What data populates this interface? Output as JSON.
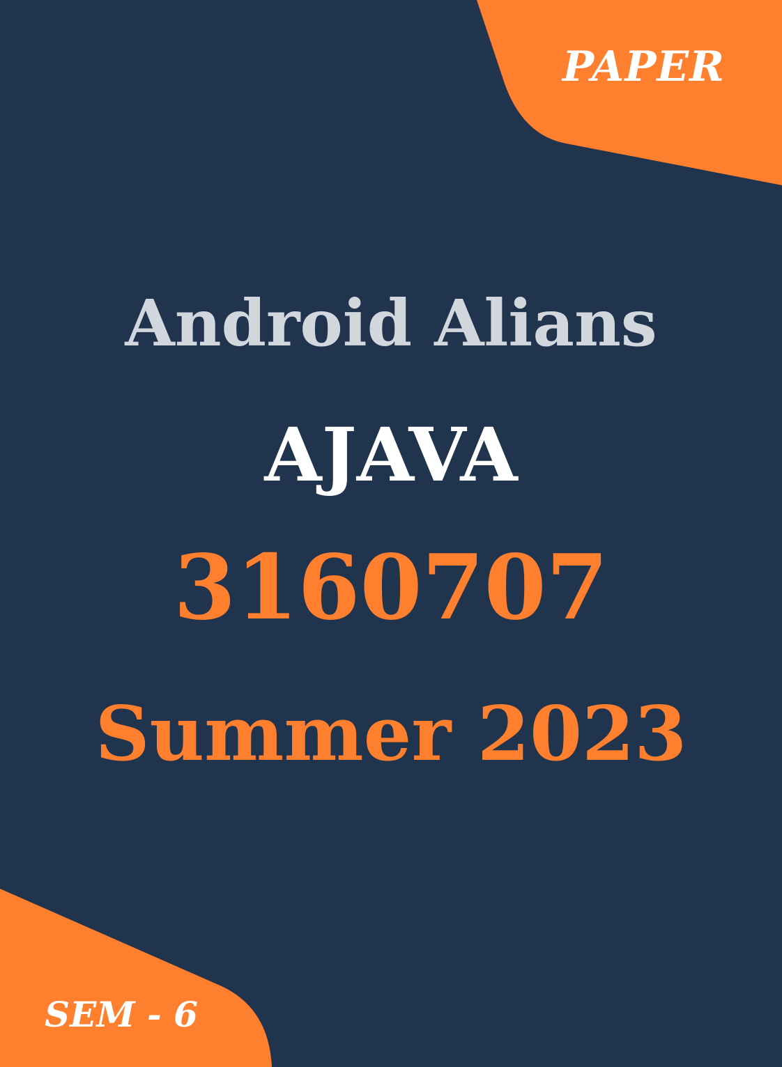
{
  "colors": {
    "background": "#21344e",
    "accent": "#fe7f2d",
    "brand_text": "#d2d7dd",
    "subject_text": "#ffffff"
  },
  "cover": {
    "paper_label": "PAPER",
    "brand_name": "Android Alians",
    "subject_name": "AJAVA",
    "subject_code": "3160707",
    "exam_session": "Summer 2023",
    "semester_label": "SEM - 6"
  }
}
